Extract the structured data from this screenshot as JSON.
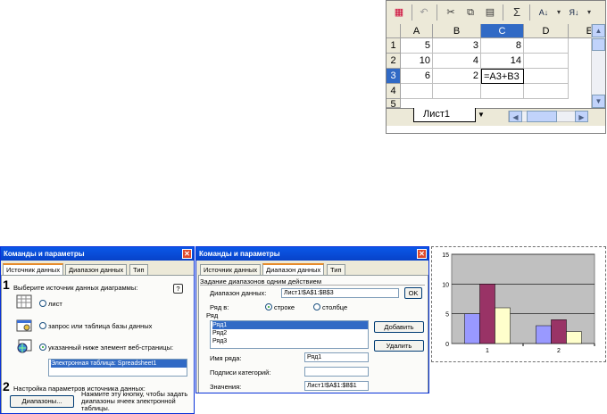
{
  "spreadsheet": {
    "toolbar": {
      "sum_label": "Σ",
      "sort_asc_label": "А↓",
      "sort_desc_label": "Я↓"
    },
    "columns": [
      "A",
      "B",
      "C",
      "D",
      "E"
    ],
    "rows": [
      {
        "num": "1",
        "a": "5",
        "b": "3",
        "c": "8"
      },
      {
        "num": "2",
        "a": "10",
        "b": "4",
        "c": "14"
      },
      {
        "num": "3",
        "a": "6",
        "b": "2",
        "c": "=A3+B3"
      },
      {
        "num": "4",
        "a": "",
        "b": "",
        "c": ""
      },
      {
        "num": "5",
        "a": "",
        "b": "",
        "c": ""
      }
    ],
    "sheet_tab": "Лист1"
  },
  "dialog1": {
    "title": "Команды и параметры",
    "tabs": [
      "Источник данных",
      "Диапазон данных",
      "Тип"
    ],
    "step1_num": "1",
    "step1_label": "Выберите источник данных диаграммы:",
    "help_label": "?",
    "option_sheet": "лист",
    "option_query": "запрос или таблица базы данных",
    "option_web": "указанный ниже элемент веб-страницы:",
    "selected_item": "Электронная таблица: Spreadsheet1",
    "step2_num": "2",
    "step2_label": "Настройка параметров источника данных:",
    "ranges_button": "Диапазоны...",
    "ranges_hint": [
      "Нажмите эту кнопку, чтобы задать",
      "диапазоны ячеек электронной",
      "таблицы."
    ]
  },
  "dialog2": {
    "title": "Команды и параметры",
    "tabs": [
      "Источник данных",
      "Диапазон данных",
      "Тип"
    ],
    "group_label": "Задание диапазонов одним действием",
    "range_label": "Диапазон данных:",
    "range_value": "Лист1!$A$1:$B$3",
    "ok_label": "OK",
    "series_in_label": "Ряд в:",
    "option_rows": "строке",
    "option_cols": "столбце",
    "series_label": "Ряд",
    "series": [
      "Ряд1",
      "Ряд2",
      "Ряд3"
    ],
    "add_button": "Добавить",
    "delete_button": "Удалить",
    "name_label": "Имя ряда:",
    "name_value": "Ряд1",
    "categories_label": "Подписи категорий:",
    "categories_value": "",
    "values_label": "Значения:",
    "values_value": "Лист1!$A$1:$B$1"
  },
  "chart_data": {
    "type": "bar",
    "categories": [
      "1",
      "2"
    ],
    "series": [
      {
        "values": [
          5,
          3
        ],
        "color": "#9999ff"
      },
      {
        "values": [
          10,
          4
        ],
        "color": "#993366"
      },
      {
        "values": [
          6,
          2
        ],
        "color": "#ffffcc"
      }
    ],
    "ylim": [
      0,
      15
    ],
    "yticks": [
      "0",
      "5",
      "10",
      "15"
    ],
    "grid": true,
    "plot_bg": "#c0c0c0"
  }
}
